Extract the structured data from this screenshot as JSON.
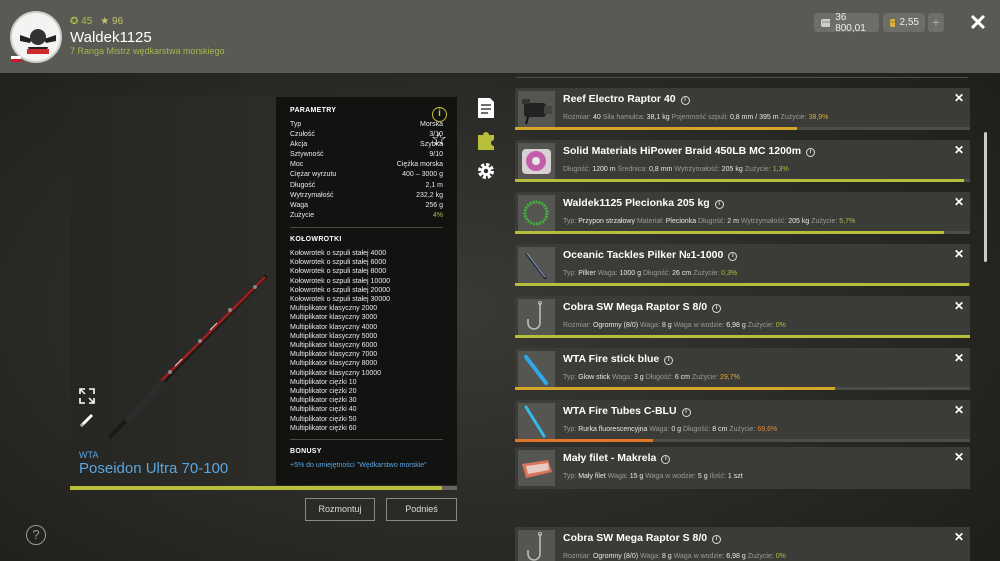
{
  "header": {
    "stat1": "45",
    "stat2": "96",
    "username": "Waldek1125",
    "rank": "7 Ranga Mistrz wędkarstwa morskiego",
    "currency_silver": "36 800,01",
    "currency_gold": "2,55",
    "plus": "+",
    "close": "✕"
  },
  "rod": {
    "brand": "WTA",
    "name": "Poseidon Ultra 70-100",
    "wear_fraction": 0.96,
    "params_title": "PARAMETRY",
    "params": [
      {
        "k": "Typ",
        "v": "Morska"
      },
      {
        "k": "Czułość",
        "v": "3/10"
      },
      {
        "k": "Akcja",
        "v": "Szybka"
      },
      {
        "k": "Sztywność",
        "v": "9/10"
      },
      {
        "k": "Moc",
        "v": "Ciężka morska"
      },
      {
        "k": "Ciężar wyrzutu",
        "v": "400 – 3000 g"
      },
      {
        "k": "Długość",
        "v": "2,1 m"
      },
      {
        "k": "Wytrzymałość",
        "v": "232,2 kg"
      },
      {
        "k": "Waga",
        "v": "256 g"
      },
      {
        "k": "Zużycie",
        "v": "4%"
      }
    ],
    "reels_title": "KOŁOWROTKI",
    "reels": [
      "Kołowrotek o szpuli stałej 4000",
      "Kołowrotek o szpuli stałej 6000",
      "Kołowrotek o szpuli stałej 8000",
      "Kołowrotek o szpuli stałej 10000",
      "Kołowrotek o szpuli stałej 20000",
      "Kołowrotek o szpuli stałej 30000",
      "Multiplikator klasyczny 2000",
      "Multiplikator klasyczny 3000",
      "Multiplikator klasyczny 4000",
      "Multiplikator klasyczny 5000",
      "Multiplikator klasyczny 6000",
      "Multiplikator klasyczny 7000",
      "Multiplikator klasyczny 8000",
      "Multiplikator klasyczny 10000",
      "Multiplikator ciężki 10",
      "Multiplikator ciężki 20",
      "Multiplikator ciężki 30",
      "Multiplikator ciężki 40",
      "Multiplikator ciężki 50",
      "Multiplikator ciężki 60"
    ],
    "bonus_title": "BONUSY",
    "bonus": "+5% do umiejętności \"Wędkarstwo morskie\""
  },
  "buttons": {
    "disassemble": "Rozmontuj",
    "pickup": "Podnieś",
    "help": "?"
  },
  "items": [
    {
      "name": "Reef Electro Raptor 40",
      "thumb": "reel",
      "wear_fraction": 0.62,
      "wear_color": "#d4a62a",
      "details": [
        [
          "Rozmiar:",
          "40"
        ],
        [
          "Siła hamulca:",
          "38,1 kg"
        ],
        [
          "Pojemność szpuli:",
          "0,8 mm / 395 m"
        ],
        [
          "Zużycie:",
          "38,9%",
          "w"
        ]
      ]
    },
    {
      "name": "Solid Materials HiPower Braid 450LB MC 1200m",
      "thumb": "spool",
      "wear_fraction": 0.987,
      "wear_color": "#b7bf3a",
      "details": [
        [
          "Długość:",
          "1200 m"
        ],
        [
          "Średnica:",
          "0,8 mm"
        ],
        [
          "Wytrzymałość:",
          "205 kg"
        ],
        [
          "Zużycie:",
          "1,3%",
          "ok"
        ]
      ]
    },
    {
      "name": "Waldek1125 Plecionka 205 kg",
      "thumb": "ring",
      "wear_fraction": 0.943,
      "wear_color": "#b7bf3a",
      "details": [
        [
          "Typ:",
          "Przypon strzałowy"
        ],
        [
          "Materiał:",
          "Plecionka"
        ],
        [
          "Długość:",
          "2 m"
        ],
        [
          "Wytrzymałość:",
          "205 kg"
        ],
        [
          "Zużycie:",
          "5,7%",
          "ok"
        ]
      ]
    },
    {
      "name": "Oceanic Tackles Pilker №1-1000",
      "thumb": "pilker",
      "wear_fraction": 0.997,
      "wear_color": "#b7bf3a",
      "details": [
        [
          "Typ:",
          "Pilker"
        ],
        [
          "Waga:",
          "1000 g"
        ],
        [
          "Długość:",
          "26 cm"
        ],
        [
          "Zużycie:",
          "0,3%",
          "ok"
        ]
      ]
    },
    {
      "name": "Cobra SW Mega Raptor S 8/0",
      "thumb": "hook",
      "wear_fraction": 1.0,
      "wear_color": "#b7bf3a",
      "details": [
        [
          "Rozmiar:",
          "Ogromny (8/0)"
        ],
        [
          "Waga:",
          "8 g"
        ],
        [
          "Waga w wodzie:",
          "6,98 g"
        ],
        [
          "Zużycie:",
          "0%",
          "ok"
        ]
      ]
    },
    {
      "name": "WTA Fire stick blue",
      "thumb": "stick",
      "wear_fraction": 0.703,
      "wear_color": "#d4a62a",
      "details": [
        [
          "Typ:",
          "Glow stick"
        ],
        [
          "Waga:",
          "3 g"
        ],
        [
          "Długość:",
          "6 cm"
        ],
        [
          "Zużycie:",
          "29,7%",
          "w"
        ]
      ]
    },
    {
      "name": "WTA Fire Tubes C-BLU",
      "thumb": "tube",
      "wear_fraction": 0.304,
      "wear_color": "#e0752a",
      "details": [
        [
          "Typ:",
          "Rurka fluorescencyjna"
        ],
        [
          "Waga:",
          "0 g"
        ],
        [
          "Długość:",
          "8 cm"
        ],
        [
          "Zużycie:",
          "69,6%",
          "o"
        ]
      ]
    },
    {
      "name": "Mały filet - Makrela",
      "thumb": "fish",
      "details": [
        [
          "Typ:",
          "Mały filet"
        ],
        [
          "Waga:",
          "15 g"
        ],
        [
          "Waga w wodzie:",
          "5 g"
        ],
        [
          "Ilość:",
          "1 szt"
        ]
      ]
    },
    {
      "name": "Cobra SW Mega Raptor S 8/0",
      "thumb": "hook",
      "details": [
        [
          "Rozmiar:",
          "Ogromny (8/0)"
        ],
        [
          "Waga:",
          "8 g"
        ],
        [
          "Waga w wodzie:",
          "6,98 g"
        ],
        [
          "Zużycie:",
          "0%",
          "ok"
        ]
      ]
    }
  ]
}
